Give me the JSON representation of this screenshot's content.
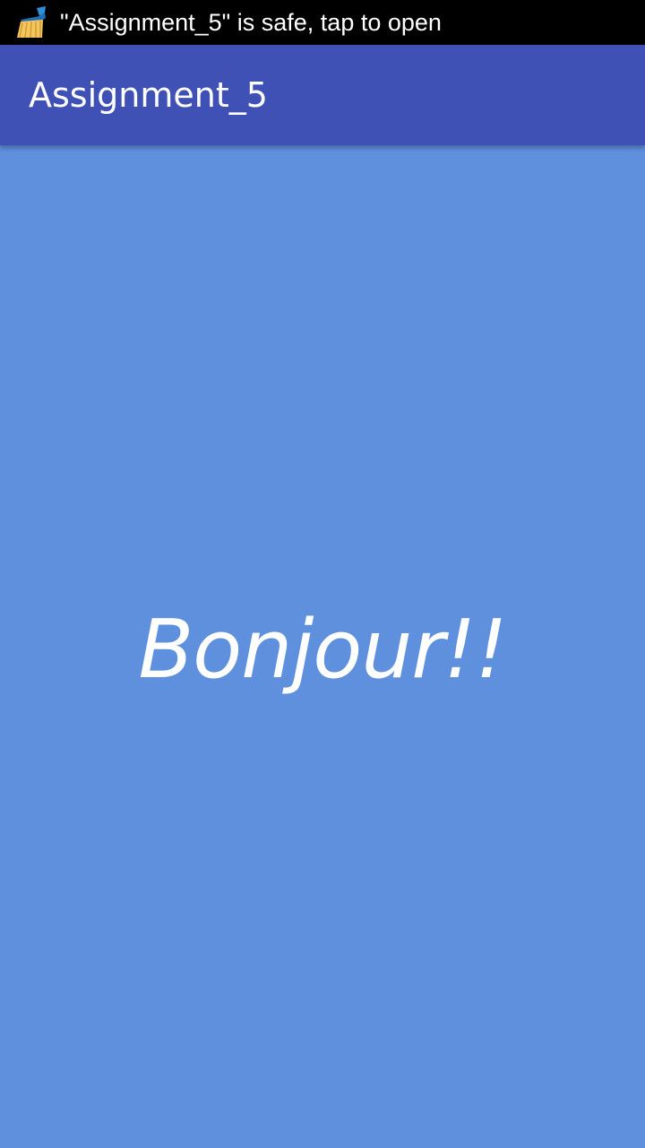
{
  "status_bar": {
    "notification_icon": "cleaner-broom-icon",
    "notification_text": "\"Assignment_5\" is safe, tap to open"
  },
  "app_bar": {
    "title": "Assignment_5",
    "color": "#3f51b5"
  },
  "main": {
    "greeting": "Bonjour!!",
    "background_color": "#5f90de"
  }
}
